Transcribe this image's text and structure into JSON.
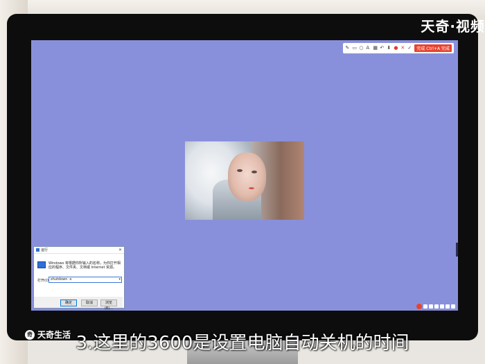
{
  "brand": {
    "text": "天奇·视频"
  },
  "toolbar": {
    "icons": [
      "pen-icon",
      "rectangle-icon",
      "circle-icon",
      "text-icon",
      "mosaic-icon",
      "undo-icon",
      "save-icon",
      "pin-icon",
      "cancel-icon",
      "confirm-icon"
    ],
    "action_label": "完成 Ctrl+A 完成",
    "accent_color": "#e8432f"
  },
  "desktop": {
    "background_color": "#8990db"
  },
  "run_dialog": {
    "title": "运行",
    "description": "Windows 将根据你所输入的名称，为你打开相应的程序、文件夹、文档或 Internet 资源。",
    "open_label": "打开(O):",
    "input_value": "shutdown -s",
    "buttons": {
      "ok": "确定",
      "cancel": "取消",
      "browse": "浏览(B)..."
    }
  },
  "watermark": {
    "logo": "奇",
    "text": "天奇生活"
  },
  "caption": {
    "text": "3.这里的3600是设置电脑自动关机的时间"
  }
}
